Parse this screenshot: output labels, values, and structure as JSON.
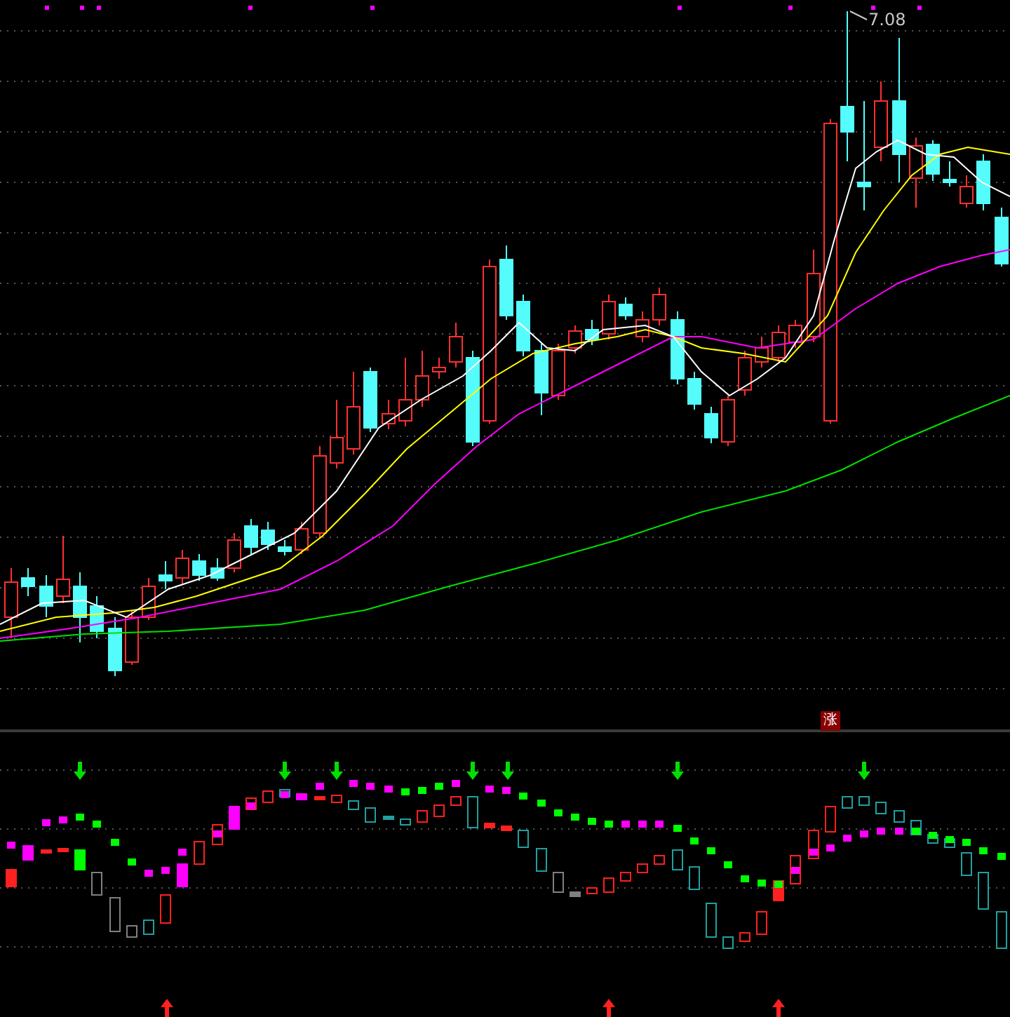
{
  "price_chart": {
    "high_label": "7.08"
  },
  "signal_badge": {
    "text": "涨"
  }
}
